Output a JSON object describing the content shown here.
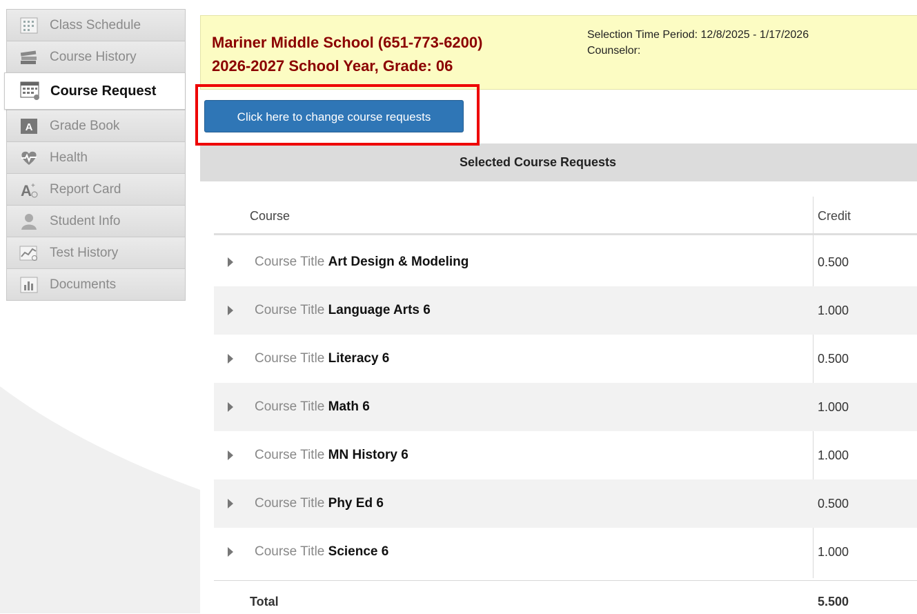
{
  "sidebar": {
    "items": [
      {
        "label": "Class Schedule",
        "icon": "calendar-grid-icon",
        "active": false
      },
      {
        "label": "Course History",
        "icon": "books-icon",
        "active": false
      },
      {
        "label": "Course Request",
        "icon": "calendar-request-icon",
        "active": true
      },
      {
        "label": "Grade Book",
        "icon": "gradebook-icon",
        "active": false
      },
      {
        "label": "Health",
        "icon": "heart-pulse-icon",
        "active": false
      },
      {
        "label": "Report Card",
        "icon": "report-card-icon",
        "active": false
      },
      {
        "label": "Student Info",
        "icon": "person-icon",
        "active": false
      },
      {
        "label": "Test History",
        "icon": "line-chart-icon",
        "active": false
      },
      {
        "label": "Documents",
        "icon": "bar-chart-doc-icon",
        "active": false
      }
    ]
  },
  "header": {
    "school_line": "Mariner Middle School (651-773-6200)",
    "year_line": "2026-2027 School Year, Grade: 06",
    "selection_period": "Selection Time Period: 12/8/2025 - 1/17/2026",
    "counselor": "Counselor:"
  },
  "change_button_label": "Click here to change course requests",
  "section_title": "Selected Course Requests",
  "table": {
    "columns": [
      "Course",
      "Credit"
    ],
    "row_prefix": "Course Title",
    "rows": [
      {
        "title": "Art Design & Modeling",
        "credit": "0.500"
      },
      {
        "title": "Language Arts 6",
        "credit": "1.000"
      },
      {
        "title": "Literacy 6",
        "credit": "0.500"
      },
      {
        "title": "Math 6",
        "credit": "1.000"
      },
      {
        "title": "MN History 6",
        "credit": "1.000"
      },
      {
        "title": "Phy Ed 6",
        "credit": "0.500"
      },
      {
        "title": "Science 6",
        "credit": "1.000"
      }
    ],
    "total_label": "Total",
    "total_value": "5.500"
  },
  "colors": {
    "school_text": "#8b0000",
    "banner_bg": "#fcfcc3",
    "button_bg": "#2f76b6",
    "highlight": "#e00000"
  }
}
